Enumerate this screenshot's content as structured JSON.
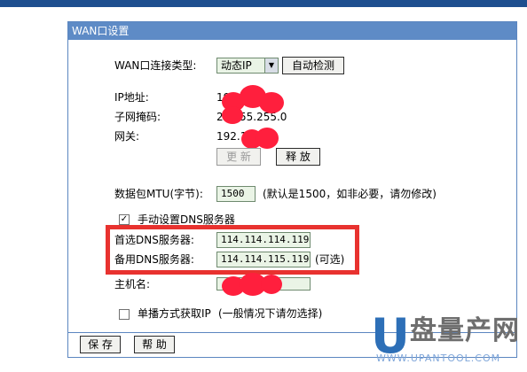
{
  "panel": {
    "title": "WAN口设置"
  },
  "wan": {
    "conn_type_label": "WAN口连接类型:",
    "conn_type_value": "动态IP",
    "detect_button": "自动检测"
  },
  "status": {
    "ip_label": "IP地址:",
    "ip_value": "19",
    "mask_label": "子网掩码:",
    "mask_value_start": "2",
    "mask_value_end": "55.255.0",
    "gateway_label": "网关:",
    "gateway_value": "192.1"
  },
  "buttons": {
    "refresh": "更 新",
    "release": "释 放",
    "save": "保 存",
    "help": "帮 助"
  },
  "mtu": {
    "label": "数据包MTU(字节):",
    "value": "1500",
    "hint": "(默认是1500，如非必要，请勿修改)"
  },
  "dns": {
    "manual_label": "手动设置DNS服务器",
    "manual_checked": true,
    "primary_label": "首选DNS服务器:",
    "primary_value": "114.114.114.119",
    "secondary_label": "备用DNS服务器:",
    "secondary_value": "114.114.115.119",
    "secondary_hint": "(可选)"
  },
  "host": {
    "label": "主机名:"
  },
  "unicast": {
    "label": "单播方式获取IP",
    "hint": "(一般情况下请勿选择)",
    "checked": false
  },
  "watermark": {
    "logo_letter": "U",
    "brand": "盘量产网",
    "site": "WWW.UPANTOOL.COM"
  },
  "colors": {
    "title_bar": "#5e8bc6",
    "field_bg": "#eaf4e6",
    "highlight": "#e8322f",
    "redaction": "#ff1f3d",
    "logo_blue": "#2d6fb7"
  }
}
